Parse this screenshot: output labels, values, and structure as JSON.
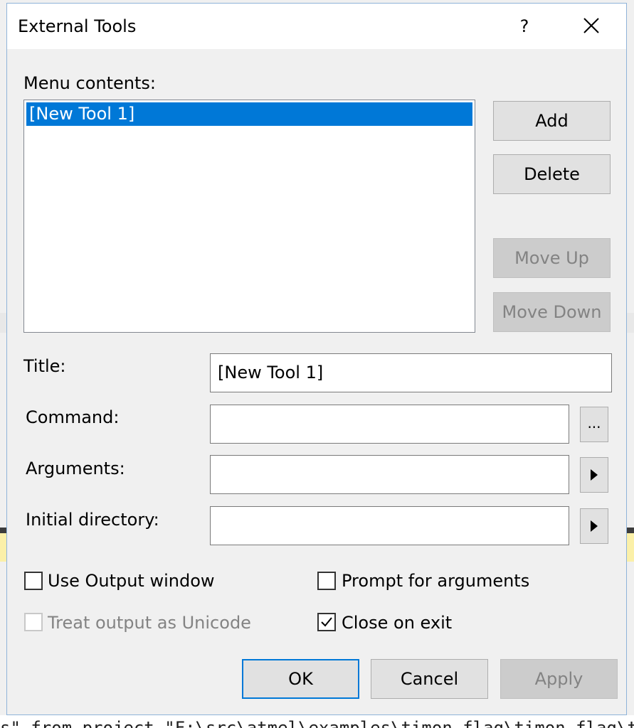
{
  "background": {
    "code_line": "s\" from project \"F:\\src\\atmel\\examples\\timon_flag\\timon_flag\\timon"
  },
  "dialog": {
    "title": "External Tools",
    "help_label": "?",
    "menu_contents_label": "Menu contents:",
    "menu_items": [
      "[New Tool 1]"
    ],
    "buttons": {
      "add": "Add",
      "delete": "Delete",
      "move_up": "Move Up",
      "move_down": "Move Down",
      "ok": "OK",
      "cancel": "Cancel",
      "apply": "Apply",
      "browse": "..."
    },
    "fields": {
      "title_label": "Title:",
      "title_value": "[New Tool 1]",
      "command_label": "Command:",
      "command_value": "",
      "arguments_label": "Arguments:",
      "arguments_value": "",
      "initial_directory_label": "Initial directory:",
      "initial_directory_value": ""
    },
    "checkboxes": {
      "use_output_window": {
        "label": "Use Output window",
        "checked": false,
        "enabled": true
      },
      "prompt_for_arguments": {
        "label": "Prompt for arguments",
        "checked": false,
        "enabled": true
      },
      "treat_output_as_unicode": {
        "label": "Treat output as Unicode",
        "checked": false,
        "enabled": false
      },
      "close_on_exit": {
        "label": "Close on exit",
        "checked": true,
        "enabled": true
      }
    }
  },
  "colors": {
    "selection": "#0078d7",
    "dialog_bg": "#f0f0f0",
    "disabled_text": "#838383",
    "focus_border": "#0078d7"
  }
}
